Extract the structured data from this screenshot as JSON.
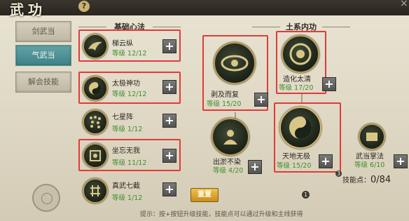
{
  "window": {
    "title": "武功",
    "help_label": "?",
    "close_label": "×"
  },
  "tabs": [
    {
      "label": "剑武当",
      "active": false
    },
    {
      "label": "气武当",
      "active": true
    },
    {
      "label": "解会技能",
      "active": false
    }
  ],
  "basic_section": {
    "title": "基础心法"
  },
  "basic_skills": [
    {
      "name": "梯云纵",
      "level": "等级 12/12",
      "selected": true
    },
    {
      "name": "太极神功",
      "level": "等级 12/12",
      "selected": true
    },
    {
      "name": "七星阵",
      "level": "等级 1/12",
      "selected": false
    },
    {
      "name": "坐忘无我",
      "level": "等级 11/12",
      "selected": true
    },
    {
      "name": "真武七截",
      "level": "等级 1/12",
      "selected": false
    }
  ],
  "tree_section": {
    "title": "土系内功"
  },
  "tree_skills": {
    "bo_ji": {
      "name": "剥及而复",
      "level": "等级 15/20"
    },
    "zao_hua": {
      "name": "造化太清",
      "level": "等级 17/20"
    },
    "chu_ni": {
      "name": "出淤不染",
      "level": "等级 4/20"
    },
    "tian_di": {
      "name": "天地无极",
      "level": "等级 15/20"
    },
    "wu_dang": {
      "name": "武当掌法",
      "level": "等级 6/10"
    }
  },
  "plus_label": "+",
  "reset_button": "重置",
  "skill_points": {
    "label": "技能点：",
    "value": "0/84"
  },
  "hint_text": "提示：按+按钮升级技能，技能点可以通过升级和主线获得",
  "badges": {
    "a": "3",
    "b": "1"
  },
  "colors": {
    "level_green": "#3f8f2e",
    "highlight_red": "#e23a3a",
    "gold_ring": "#b59b56",
    "active_tab": "#4b8e92"
  }
}
